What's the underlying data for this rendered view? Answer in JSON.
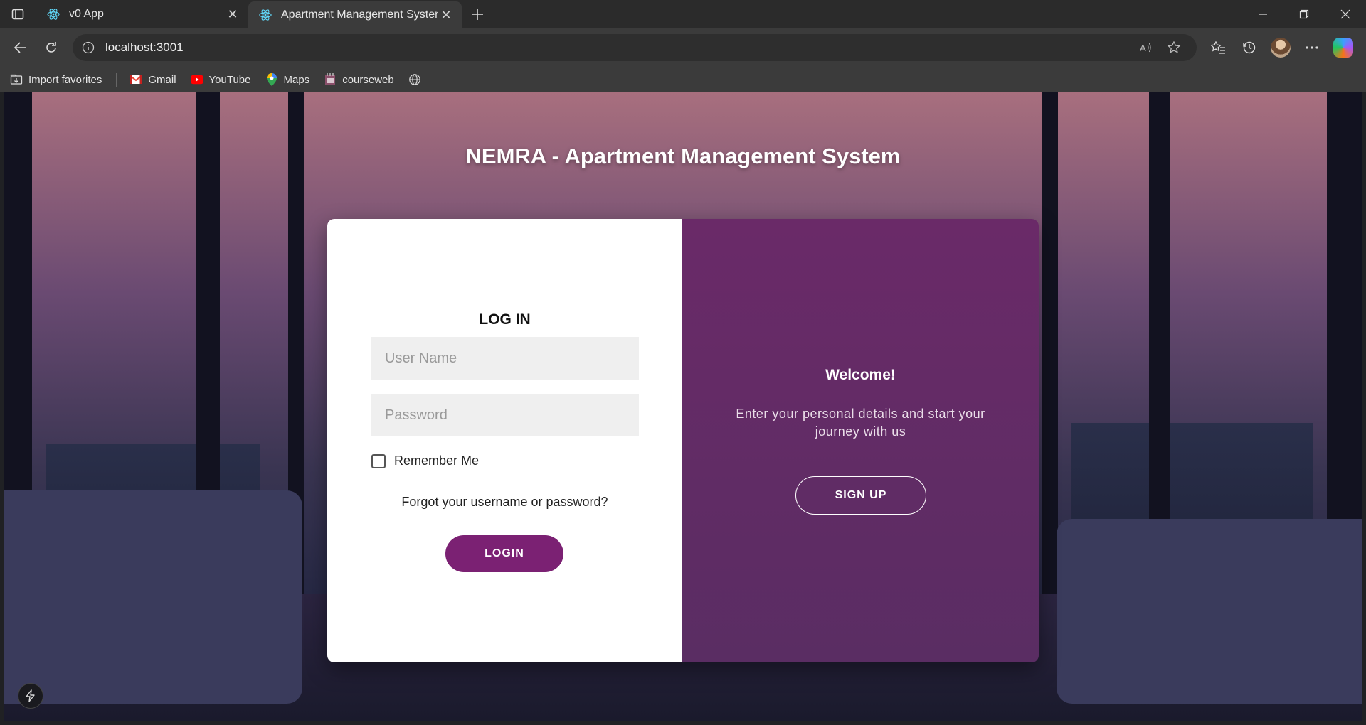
{
  "browser": {
    "tabs": [
      {
        "title": "v0 App",
        "active": false
      },
      {
        "title": "Apartment Management System",
        "active": true
      }
    ],
    "url": "localhost:3001",
    "bookmarks": [
      {
        "label": "Import favorites",
        "icon": "import-icon"
      },
      {
        "label": "Gmail",
        "icon": "gmail-icon"
      },
      {
        "label": "YouTube",
        "icon": "youtube-icon"
      },
      {
        "label": "Maps",
        "icon": "maps-icon"
      },
      {
        "label": "courseweb",
        "icon": "courseweb-icon"
      }
    ]
  },
  "page": {
    "title": "NEMRA - Apartment Management System"
  },
  "login": {
    "heading": "LOG IN",
    "username_placeholder": "User Name",
    "password_placeholder": "Password",
    "remember_label": "Remember Me",
    "forgot_label": "Forgot your username or password?",
    "login_button": "LOGIN"
  },
  "signup_panel": {
    "heading": "Welcome!",
    "text": "Enter your personal details and start your journey with us",
    "signup_button": "SIGN UP"
  },
  "colors": {
    "accent": "#7b2173",
    "panel": "#5f2c64"
  }
}
